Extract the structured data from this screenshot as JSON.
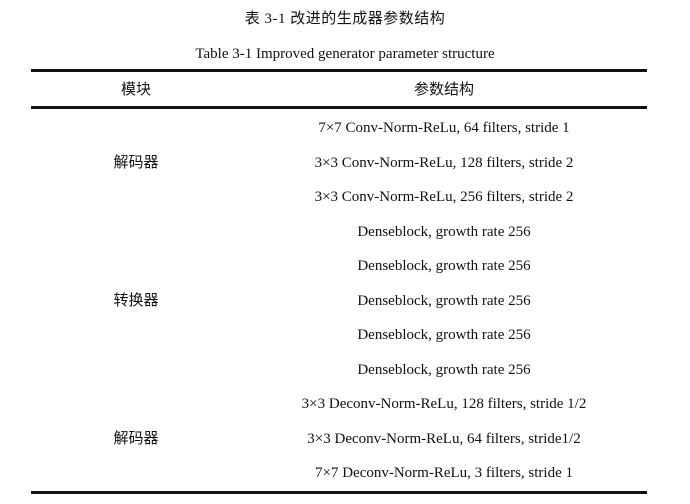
{
  "caption": {
    "cn": "表 3-1  改进的生成器参数结构",
    "en": "Table 3-1 Improved generator parameter structure"
  },
  "table": {
    "headers": [
      "模块",
      "参数结构"
    ],
    "groups": [
      {
        "module": "解码器",
        "rows": [
          "7×7 Conv-Norm-ReLu, 64 filters, stride 1",
          "3×3 Conv-Norm-ReLu, 128 filters, stride 2",
          "3×3 Conv-Norm-ReLu, 256 filters, stride 2"
        ]
      },
      {
        "module": "转换器",
        "rows": [
          "Denseblock, growth rate 256",
          "Denseblock, growth rate 256",
          "Denseblock, growth rate 256",
          "Denseblock, growth rate 256",
          "Denseblock, growth rate 256"
        ]
      },
      {
        "module": "解码器",
        "rows": [
          "3×3 Deconv-Norm-ReLu, 128 filters, stride 1/2",
          "3×3 Deconv-Norm-ReLu, 64 filters, stride1/2",
          "7×7 Deconv-Norm-ReLu, 3 filters, stride 1"
        ]
      }
    ]
  }
}
